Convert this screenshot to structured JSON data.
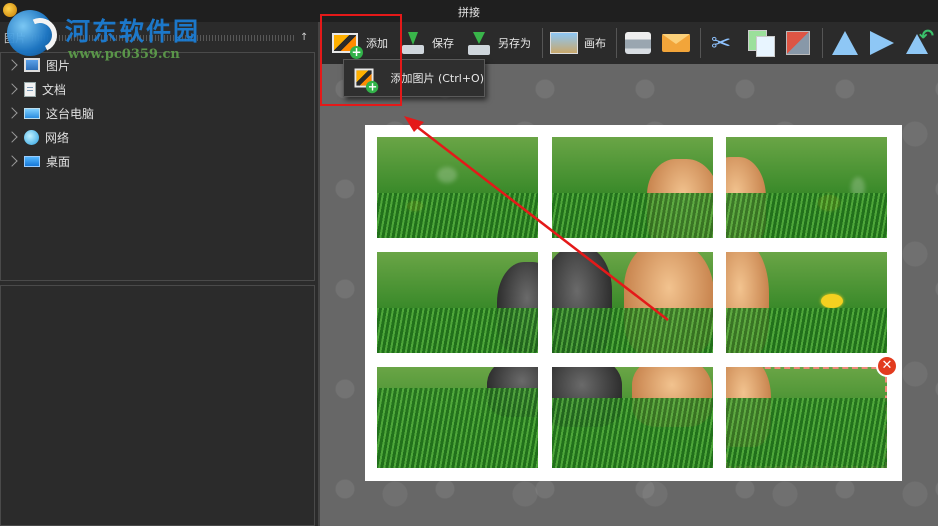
{
  "window": {
    "title": "拼接"
  },
  "watermark": {
    "brand": "河东软件园",
    "url": "www.pc0359.cn"
  },
  "left_panel": {
    "title": "图片",
    "tree": [
      {
        "label": "图片",
        "icon": "pictures-folder-icon"
      },
      {
        "label": "文档",
        "icon": "documents-icon"
      },
      {
        "label": "这台电脑",
        "icon": "this-pc-icon"
      },
      {
        "label": "网络",
        "icon": "network-icon"
      },
      {
        "label": "桌面",
        "icon": "desktop-icon"
      }
    ]
  },
  "toolbar": {
    "add_label": "添加",
    "save_label": "保存",
    "saveas_label": "另存为",
    "canvas_label": "画布"
  },
  "dropdown": {
    "add_image_label": "添加图片 (Ctrl+O)"
  },
  "colors": {
    "highlight": "#e41919",
    "close": "#e23b1e",
    "selection": "#f08a7a"
  }
}
